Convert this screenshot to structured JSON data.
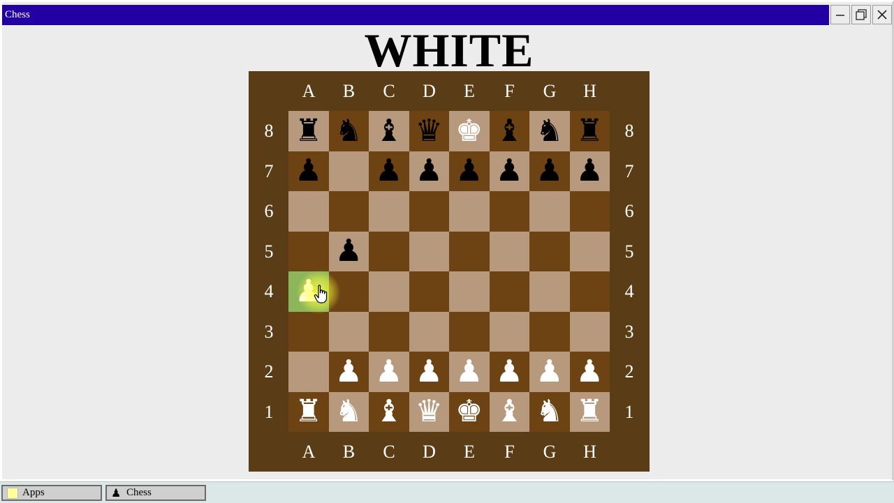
{
  "window": {
    "title": "Chess",
    "controls": [
      "minimize",
      "maximize",
      "close"
    ]
  },
  "turn_title": "WHITE",
  "board": {
    "files": [
      "A",
      "B",
      "C",
      "D",
      "E",
      "F",
      "G",
      "H"
    ],
    "ranks": [
      "8",
      "7",
      "6",
      "5",
      "4",
      "3",
      "2",
      "1"
    ],
    "highlighted_square": "a4",
    "light_color": "#b79a7e",
    "dark_color": "#6e4313",
    "highlight_color": "#8cb65a",
    "frame_color": "#5a3d16",
    "position": [
      [
        "bR",
        "bN",
        "bB",
        "bQ",
        "wK",
        "bB",
        "bN",
        "bR"
      ],
      [
        "bP",
        "",
        "bP",
        "bP",
        "bP",
        "bP",
        "bP",
        "bP"
      ],
      [
        "",
        "",
        "",
        "",
        "",
        "",
        "",
        ""
      ],
      [
        "",
        "bP",
        "",
        "",
        "",
        "",
        "",
        ""
      ],
      [
        "wP",
        "",
        "",
        "",
        "",
        "",
        "",
        ""
      ],
      [
        "",
        "",
        "",
        "",
        "",
        "",
        "",
        ""
      ],
      [
        "",
        "wP",
        "wP",
        "wP",
        "wP",
        "wP",
        "wP",
        "wP"
      ],
      [
        "wR",
        "wN",
        "wB",
        "wQ",
        "wK",
        "wB",
        "wN",
        "wR"
      ]
    ]
  },
  "taskbar": {
    "items": [
      {
        "label": "Apps",
        "icon": "apps-icon"
      },
      {
        "label": "Chess",
        "icon": "pawn-icon"
      }
    ]
  },
  "colors": {
    "titlebar": "#2200a4",
    "window_bg": "#ececec"
  }
}
